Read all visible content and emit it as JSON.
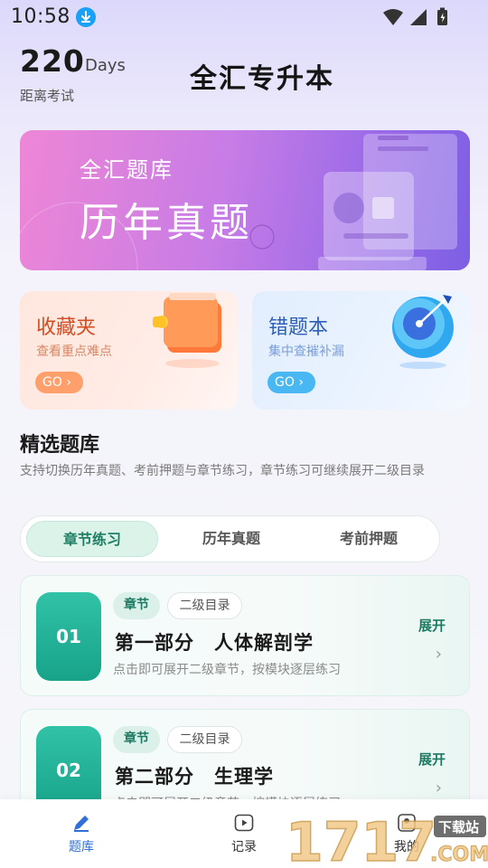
{
  "status_bar": {
    "time": "10:58",
    "icons": [
      "download-icon",
      "wifi-icon",
      "signal-icon",
      "battery-icon"
    ]
  },
  "header": {
    "days_count": "220",
    "days_unit": "Days",
    "days_caption": "距离考试",
    "app_title": "全汇专升本"
  },
  "banner": {
    "subtitle": "全汇题库",
    "title": "历年真题"
  },
  "cards": {
    "favorites": {
      "title": "收藏夹",
      "desc": "查看重点难点",
      "go": "GO"
    },
    "wrong_book": {
      "title": "错题本",
      "desc": "集中查摧补漏",
      "go": "GO"
    }
  },
  "section": {
    "title": "精选题库",
    "desc": "支持切换历年真题、考前押题与章节练习，章节练习可继续展开二级目录"
  },
  "tabs": [
    {
      "label": "章节练习",
      "active": true
    },
    {
      "label": "历年真题",
      "active": false
    },
    {
      "label": "考前押题",
      "active": false
    }
  ],
  "chapters": [
    {
      "num": "01",
      "tag": "章节",
      "level_tag": "二级目录",
      "title": "第一部分　人体解剖学",
      "desc": "点击即可展开二级章节，按模块逐层练习",
      "expand": "展开"
    },
    {
      "num": "02",
      "tag": "章节",
      "level_tag": "二级目录",
      "title": "第二部分　生理学",
      "desc": "点击即可展开二级章节，按模块逐层练习",
      "expand": "展开"
    }
  ],
  "bottom_nav": [
    {
      "label": "题库",
      "icon": "pencil-icon",
      "active": true
    },
    {
      "label": "记录",
      "icon": "play-icon",
      "active": false
    },
    {
      "label": "我的",
      "icon": "user-icon",
      "active": false
    }
  ],
  "watermark": {
    "brand": "1717",
    "badge": "下载站",
    "domain": ".COM"
  },
  "colors": {
    "accent_green": "#1b7a61",
    "nav_active": "#2f6fd6",
    "banner_pink": "#ee86d6",
    "banner_purple": "#7d5fe4"
  }
}
